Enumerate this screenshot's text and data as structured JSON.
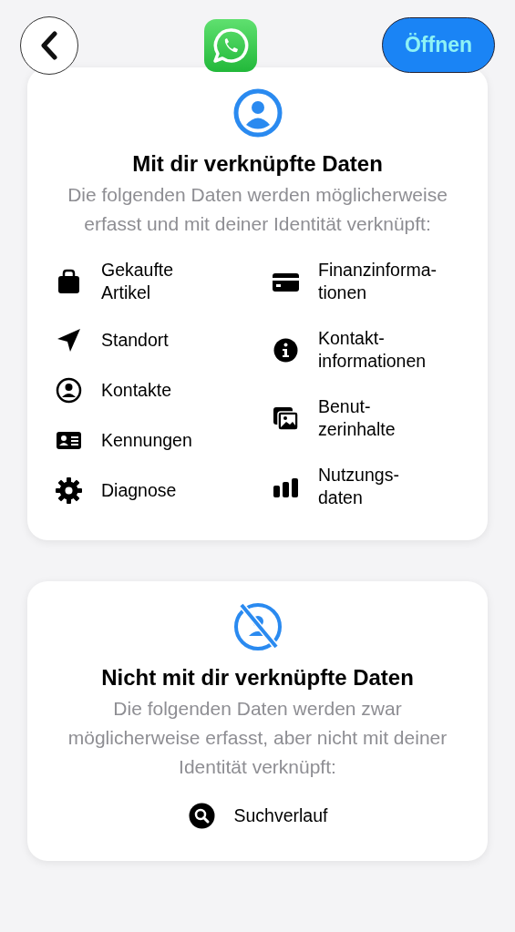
{
  "header": {
    "open_button": "Öffnen"
  },
  "sections": [
    {
      "kind": "linked",
      "title": "Mit dir verknüpfte Daten",
      "description": "Die folgenden Daten werden möglicherweise erfasst und mit deiner Identität verknüpft:",
      "columns": [
        [
          "Gekaufte\nArtikel",
          "Standort",
          "Kontakte",
          "Kennungen",
          "Diagnose"
        ],
        [
          "Finanzinforma-\ntionen",
          "Kontakt-\ninformationen",
          "Benut-\nzerinhalte",
          "Nutzungs-\ndaten"
        ]
      ]
    },
    {
      "kind": "unlinked",
      "title": "Nicht mit dir verknüpfte Daten",
      "description": "Die folgenden Daten werden zwar möglicherweise erfasst, aber nicht mit deiner Identität verknüpft:",
      "columns": [
        [
          "Suchverlauf"
        ]
      ]
    }
  ]
}
